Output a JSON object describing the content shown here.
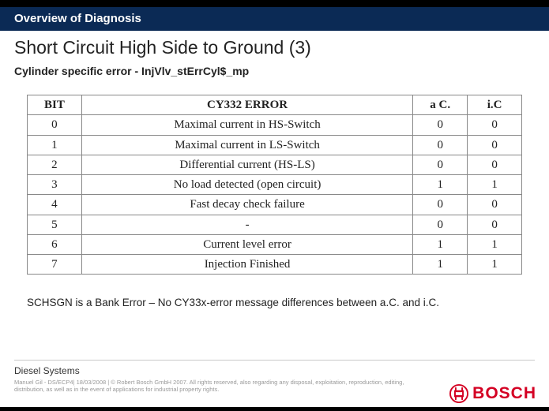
{
  "header": "Overview of Diagnosis",
  "title": "Short Circuit High Side to Ground (3)",
  "subtitle": "Cylinder specific error - InjVlv_stErrCyl$_mp",
  "table": {
    "headers": {
      "bit": "BIT",
      "err": "CY332 ERROR",
      "ac": "a C.",
      "ic": "i.C"
    },
    "rows": [
      {
        "bit": "0",
        "err": "Maximal current in HS-Switch",
        "ac": "0",
        "ic": "0"
      },
      {
        "bit": "1",
        "err": "Maximal current in LS-Switch",
        "ac": "0",
        "ic": "0"
      },
      {
        "bit": "2",
        "err": "Differential current (HS-LS)",
        "ac": "0",
        "ic": "0"
      },
      {
        "bit": "3",
        "err": "No load detected (open circuit)",
        "ac": "1",
        "ic": "1"
      },
      {
        "bit": "4",
        "err": "Fast decay check failure",
        "ac": "0",
        "ic": "0"
      },
      {
        "bit": "5",
        "err": "-",
        "ac": "0",
        "ic": "0"
      },
      {
        "bit": "6",
        "err": "Current level error",
        "ac": "1",
        "ic": "1"
      },
      {
        "bit": "7",
        "err": "Injection Finished",
        "ac": "1",
        "ic": "1"
      }
    ]
  },
  "note": "SCHSGN is a Bank Error – No CY33x-error message differences between a.C. and i.C.",
  "footer": {
    "diesel": "Diesel Systems",
    "legal": "Manuel Gil - DS/ECP4| 18/03/2008 | © Robert Bosch GmbH 2007. All rights reserved, also regarding any disposal, exploitation, reproduction, editing, distribution, as well as in the event of applications for industrial property rights.",
    "logo_text": "BOSCH"
  }
}
